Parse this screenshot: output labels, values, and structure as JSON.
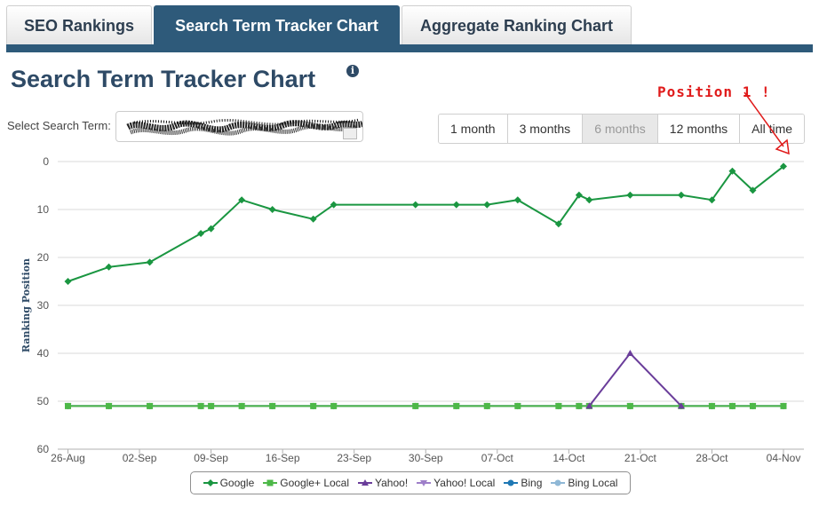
{
  "tabs": [
    {
      "label": "SEO Rankings",
      "active": false
    },
    {
      "label": "Search Term Tracker Chart",
      "active": true
    },
    {
      "label": "Aggregate Ranking Chart",
      "active": false
    }
  ],
  "page": {
    "title": "Search Term Tracker Chart",
    "info_icon": "info-icon",
    "select_label": "Select Search Term:",
    "annotation": "Position 1 !"
  },
  "range_buttons": [
    {
      "label": "1 month",
      "selected": false
    },
    {
      "label": "3 months",
      "selected": false
    },
    {
      "label": "6 months",
      "selected": true
    },
    {
      "label": "12 months",
      "selected": false
    },
    {
      "label": "All time",
      "selected": false
    }
  ],
  "colors": {
    "tab_active": "#2e5a7a",
    "google": "#1a9641",
    "google_local": "#4db848",
    "yahoo": "#6a3d9a",
    "yahoo_local": "#9e7fc9",
    "bing": "#1f78b4",
    "bing_local": "#8fb8d6",
    "annotation": "#e01b1b"
  },
  "chart_data": {
    "type": "line",
    "ylabel": "Ranking Position",
    "xlabel": "",
    "y_reversed": true,
    "ylim": [
      0,
      60
    ],
    "yticks": [
      0,
      10,
      20,
      30,
      40,
      50,
      60
    ],
    "xlim": [
      "2014-08-25",
      "2014-11-06"
    ],
    "xticks": [
      {
        "label": "26-Aug",
        "date": "2014-08-26"
      },
      {
        "label": "02-Sep",
        "date": "2014-09-02"
      },
      {
        "label": "09-Sep",
        "date": "2014-09-09"
      },
      {
        "label": "16-Sep",
        "date": "2014-09-16"
      },
      {
        "label": "23-Sep",
        "date": "2014-09-23"
      },
      {
        "label": "30-Sep",
        "date": "2014-09-30"
      },
      {
        "label": "07-Oct",
        "date": "2014-10-07"
      },
      {
        "label": "14-Oct",
        "date": "2014-10-14"
      },
      {
        "label": "21-Oct",
        "date": "2014-10-21"
      },
      {
        "label": "28-Oct",
        "date": "2014-10-28"
      },
      {
        "label": "04-Nov",
        "date": "2014-11-04"
      }
    ],
    "x": [
      "2014-08-26",
      "2014-08-30",
      "2014-09-03",
      "2014-09-08",
      "2014-09-09",
      "2014-09-12",
      "2014-09-15",
      "2014-09-19",
      "2014-09-21",
      "2014-09-29",
      "2014-10-03",
      "2014-10-06",
      "2014-10-09",
      "2014-10-13",
      "2014-10-15",
      "2014-10-16",
      "2014-10-20",
      "2014-10-25",
      "2014-10-28",
      "2014-10-30",
      "2014-11-01",
      "2014-11-04"
    ],
    "series": [
      {
        "name": "Google",
        "marker": "diamond",
        "values": [
          25,
          22,
          21,
          15,
          14,
          8,
          10,
          12,
          9,
          9,
          9,
          9,
          8,
          13,
          7,
          8,
          7,
          7,
          8,
          2,
          6,
          1
        ]
      },
      {
        "name": "Google+ Local",
        "marker": "square",
        "values": [
          51,
          51,
          51,
          51,
          51,
          51,
          51,
          51,
          51,
          51,
          51,
          51,
          51,
          51,
          51,
          51,
          51,
          51,
          51,
          51,
          51,
          51
        ]
      },
      {
        "name": "Yahoo!",
        "marker": "triangle",
        "values": [
          null,
          null,
          null,
          null,
          null,
          null,
          null,
          null,
          null,
          null,
          null,
          null,
          null,
          null,
          null,
          51,
          40,
          51,
          null,
          null,
          null,
          null
        ]
      },
      {
        "name": "Yahoo! Local",
        "marker": "triangle-down",
        "values": [
          51,
          51,
          51,
          51,
          51,
          51,
          51,
          51,
          51,
          51,
          51,
          51,
          51,
          51,
          51,
          51,
          51,
          51,
          51,
          51,
          51,
          51
        ]
      },
      {
        "name": "Bing",
        "marker": "circle",
        "values": [
          51,
          51,
          51,
          51,
          51,
          51,
          51,
          51,
          51,
          51,
          51,
          51,
          51,
          51,
          51,
          51,
          51,
          51,
          51,
          51,
          51,
          51
        ]
      },
      {
        "name": "Bing Local",
        "marker": "circle",
        "values": [
          51,
          51,
          51,
          51,
          51,
          51,
          51,
          51,
          51,
          51,
          51,
          51,
          51,
          51,
          51,
          51,
          51,
          51,
          51,
          51,
          51,
          51
        ]
      }
    ],
    "grid": true,
    "legend": "bottom"
  }
}
